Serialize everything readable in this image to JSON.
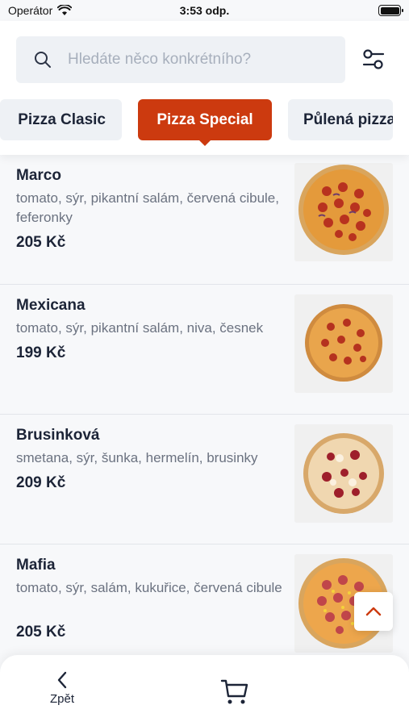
{
  "status_bar": {
    "carrier": "Operátor",
    "time": "3:53 odp."
  },
  "search": {
    "placeholder": "Hledáte něco konkrétního?"
  },
  "categories": [
    {
      "label": "Pizza Clasic"
    },
    {
      "label": "Pizza Special",
      "selected": true
    },
    {
      "label": "Půlená pizza"
    }
  ],
  "items": [
    {
      "name": "Marco",
      "desc": "tomato, sýr, pikantní salám, červená cibule, feferonky",
      "price": "205 Kč"
    },
    {
      "name": "Mexicana",
      "desc": "tomato, sýr, pikantní salám, niva, česnek",
      "price": "199 Kč"
    },
    {
      "name": "Brusinková",
      "desc": "smetana, sýr, šunka, hermelín, brusinky",
      "price": "209 Kč"
    },
    {
      "name": "Mafia",
      "desc": "tomato, sýr, salám, kukuřice, červená cibule",
      "price": "205 Kč"
    }
  ],
  "bottom_nav": {
    "back_label": "Zpět"
  },
  "icons": {
    "search": "search-icon",
    "filter": "filter-sliders-icon",
    "scroll_top": "chevron-up-icon",
    "back": "chevron-left-icon",
    "cart": "cart-icon"
  },
  "colors": {
    "accent": "#cc3a0f",
    "text": "#1c2437",
    "muted": "#6b7280"
  }
}
